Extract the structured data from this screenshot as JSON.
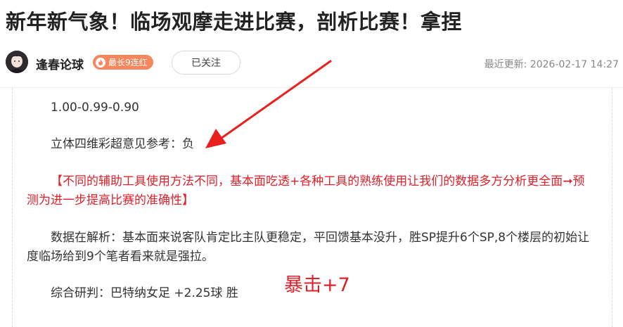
{
  "article": {
    "title": "新年新气象！临场观摩走进比赛，剖析比赛！拿捏"
  },
  "author": {
    "name": "逢春论球",
    "streak_badge": "最长9连红",
    "follow_label": "已关注",
    "update_label": "最近更新:",
    "update_time": "2026-02-17 14:27"
  },
  "content": {
    "odds": "1.00-0.99-0.90",
    "reference": "立体四维彩超意见参考：负",
    "notice": "【不同的辅助工具使用方法不同，基本面吃透+各种工具的熟练使用让我们的数据多方分析更全面➞预测为进一步提高比赛的准确性】",
    "analysis": "数据在解析：基本面来说客队肯定比主队更稳定，平回馈基本没升，胜SP提升6个SP,8个楼层的初始让度临场给到9个笔者看来就是强拉。",
    "conclusion": "综合研判：巴特纳女足 +2.25球 胜",
    "crit": "暴击+7"
  },
  "colors": {
    "accent_red": "#e0212a",
    "badge_orange": "#f6865d",
    "arrow_red": "#e8201e"
  },
  "icons": {
    "streak": "fire-icon",
    "annotation": "red-arrow-icon"
  }
}
